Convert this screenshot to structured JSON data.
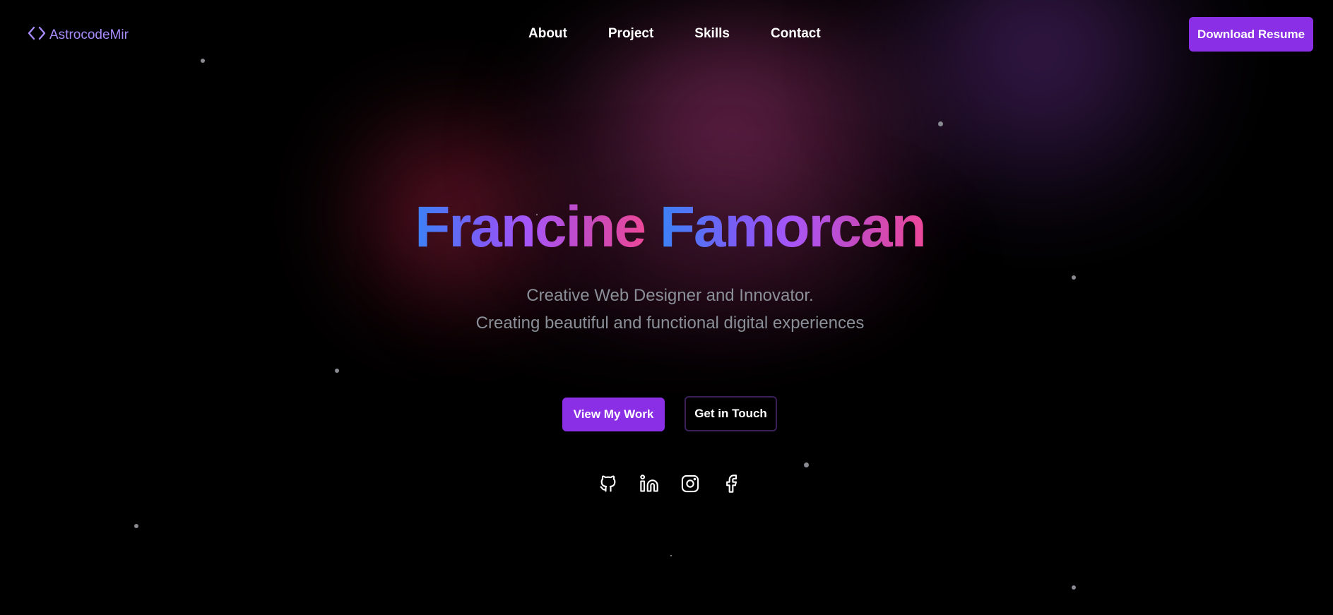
{
  "brand": {
    "logo_text": "AstrocodeMir",
    "accent": "#a78bfa"
  },
  "nav": {
    "items": [
      {
        "label": "About"
      },
      {
        "label": "Project"
      },
      {
        "label": "Skills"
      },
      {
        "label": "Contact"
      }
    ]
  },
  "header": {
    "resume_button": "Download Resume"
  },
  "hero": {
    "first_name": "Francine",
    "last_name": "Famorcan",
    "tagline": "Creative Web Designer and Innovator.",
    "description": "Creating beautiful and functional digital experiences",
    "primary_button": "View My Work",
    "secondary_button": "Get in Touch"
  },
  "socials": [
    {
      "icon": "github-icon"
    },
    {
      "icon": "linkedin-icon"
    },
    {
      "icon": "instagram-icon"
    },
    {
      "icon": "facebook-icon"
    }
  ],
  "colors": {
    "background": "#000000",
    "button": "#8b2fe6",
    "gradient_start": "#3b82f6",
    "gradient_end": "#ec4899"
  }
}
